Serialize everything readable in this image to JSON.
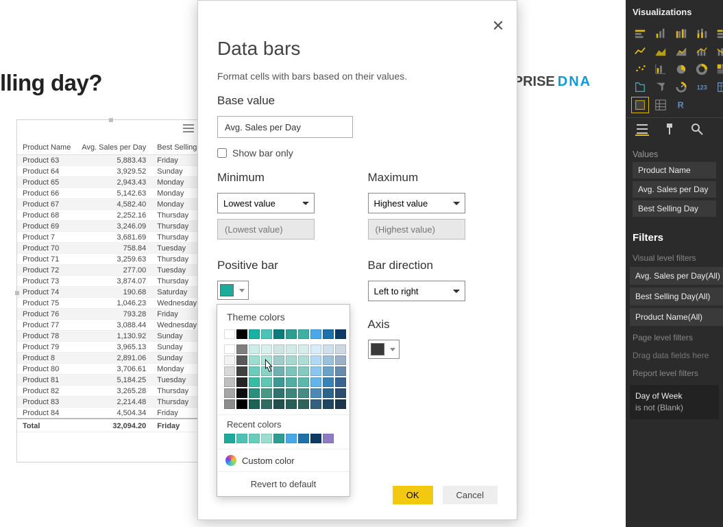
{
  "canvas": {
    "heading": "lling day?",
    "brand_a": "NTERPRISE",
    "brand_b": "DNA"
  },
  "table": {
    "columns": [
      "Product Name",
      "Avg. Sales per Day",
      "Best Selling"
    ],
    "rows": [
      [
        "Product 63",
        "5,883.43",
        "Friday"
      ],
      [
        "Product 64",
        "3,929.52",
        "Sunday"
      ],
      [
        "Product 65",
        "2,943.43",
        "Monday"
      ],
      [
        "Product 66",
        "5,142.63",
        "Monday"
      ],
      [
        "Product 67",
        "4,582.40",
        "Monday"
      ],
      [
        "Product 68",
        "2,252.16",
        "Thursday"
      ],
      [
        "Product 69",
        "3,246.09",
        "Thursday"
      ],
      [
        "Product 7",
        "3,681.69",
        "Thursday"
      ],
      [
        "Product 70",
        "758.84",
        "Tuesday"
      ],
      [
        "Product 71",
        "3,259.63",
        "Thursday"
      ],
      [
        "Product 72",
        "277.00",
        "Tuesday"
      ],
      [
        "Product 73",
        "3,874.07",
        "Thursday"
      ],
      [
        "Product 74",
        "190.68",
        "Saturday"
      ],
      [
        "Product 75",
        "1,046.23",
        "Wednesday"
      ],
      [
        "Product 76",
        "793.28",
        "Friday"
      ],
      [
        "Product 77",
        "3,088.44",
        "Wednesday"
      ],
      [
        "Product 78",
        "1,130.92",
        "Sunday"
      ],
      [
        "Product 79",
        "3,965.13",
        "Sunday"
      ],
      [
        "Product 8",
        "2,891.06",
        "Sunday"
      ],
      [
        "Product 80",
        "3,706.61",
        "Monday"
      ],
      [
        "Product 81",
        "5,184.25",
        "Tuesday"
      ],
      [
        "Product 82",
        "3,265.28",
        "Thursday"
      ],
      [
        "Product 83",
        "2,214.48",
        "Thursday"
      ],
      [
        "Product 84",
        "4,504.34",
        "Friday"
      ]
    ],
    "footer": [
      "Total",
      "32,094.20",
      "Friday"
    ]
  },
  "dialog": {
    "title": "Data bars",
    "subtitle": "Format cells with bars based on their values.",
    "base_label": "Base value",
    "base_value": "Avg. Sales per Day",
    "show_bar_only": "Show bar only",
    "min_label": "Minimum",
    "max_label": "Maximum",
    "min_select": "Lowest value",
    "max_select": "Highest value",
    "min_ph": "(Lowest value)",
    "max_ph": "(Highest value)",
    "pos_bar": "Positive bar",
    "bar_dir": "Bar direction",
    "bar_dir_value": "Left to right",
    "axis_label": "Axis",
    "ok": "OK",
    "cancel": "Cancel",
    "pos_color": "#1aab9b",
    "axis_color": "#3a3a3a"
  },
  "colorpicker": {
    "theme_title": "Theme colors",
    "recent_title": "Recent colors",
    "custom": "Custom color",
    "revert": "Revert to default",
    "row_top": [
      "#ffffff",
      "#000000",
      "#16b2a3",
      "#4fc2b6",
      "#0e7c7b",
      "#2f9e92",
      "#3fb0a4",
      "#4aa7e8",
      "#1f6fa8",
      "#0d3b66"
    ],
    "shade_cols": [
      [
        "#ffffff",
        "#f2f2f2",
        "#d9d9d9",
        "#bfbfbf",
        "#a6a6a6",
        "#8c8c8c"
      ],
      [
        "#7f7f7f",
        "#595959",
        "#404040",
        "#262626",
        "#0d0d0d",
        "#000000"
      ],
      [
        "#cdeee8",
        "#9bddd1",
        "#6acdbb",
        "#39bca4",
        "#2a8f7d",
        "#1c6256"
      ],
      [
        "#d7f0ec",
        "#afe2d9",
        "#87d3c7",
        "#5fc5b4",
        "#48988a",
        "#316b61"
      ],
      [
        "#cfe5e4",
        "#9fcbc9",
        "#6fb1ae",
        "#3f9894",
        "#307471",
        "#21504e"
      ],
      [
        "#d3ebe8",
        "#a7d7d1",
        "#7bc3bb",
        "#4fafa4",
        "#3c867e",
        "#295d58"
      ],
      [
        "#d6edea",
        "#adDbd6",
        "#85c9c1",
        "#5cb7ad",
        "#468c84",
        "#30615b"
      ],
      [
        "#d8ecf9",
        "#b1d9f3",
        "#8ac7ee",
        "#63b4e8",
        "#4b8ab2",
        "#34607c"
      ],
      [
        "#cde0ec",
        "#9bc1da",
        "#6aa2c7",
        "#3883b5",
        "#2b658b",
        "#1e4661"
      ],
      [
        "#cdd8e3",
        "#9bb1c7",
        "#6a8aab",
        "#38648f",
        "#2b4d6e",
        "#1e364d"
      ]
    ],
    "recent": [
      "#1aab9b",
      "#4fc2b6",
      "#6acdbb",
      "#9bddd1",
      "#2f9e92",
      "#4aa7e8",
      "#1f6fa8",
      "#0d3b66",
      "#8e7cc3"
    ]
  },
  "side": {
    "title": "Visualizations",
    "values_label": "Values",
    "wells": [
      "Product Name",
      "Avg. Sales per Day",
      "Best Selling Day"
    ],
    "filters_title": "Filters",
    "vlf_label": "Visual level filters",
    "vlf": [
      "Avg. Sales per Day(All)",
      "Best Selling Day(All)",
      "Product Name(All)"
    ],
    "plf_label": "Page level filters",
    "plf_hint": "Drag data fields here",
    "rlf_label": "Report level filters",
    "rlf_item_l1": "Day of Week",
    "rlf_item_l2": "is not (Blank)"
  }
}
